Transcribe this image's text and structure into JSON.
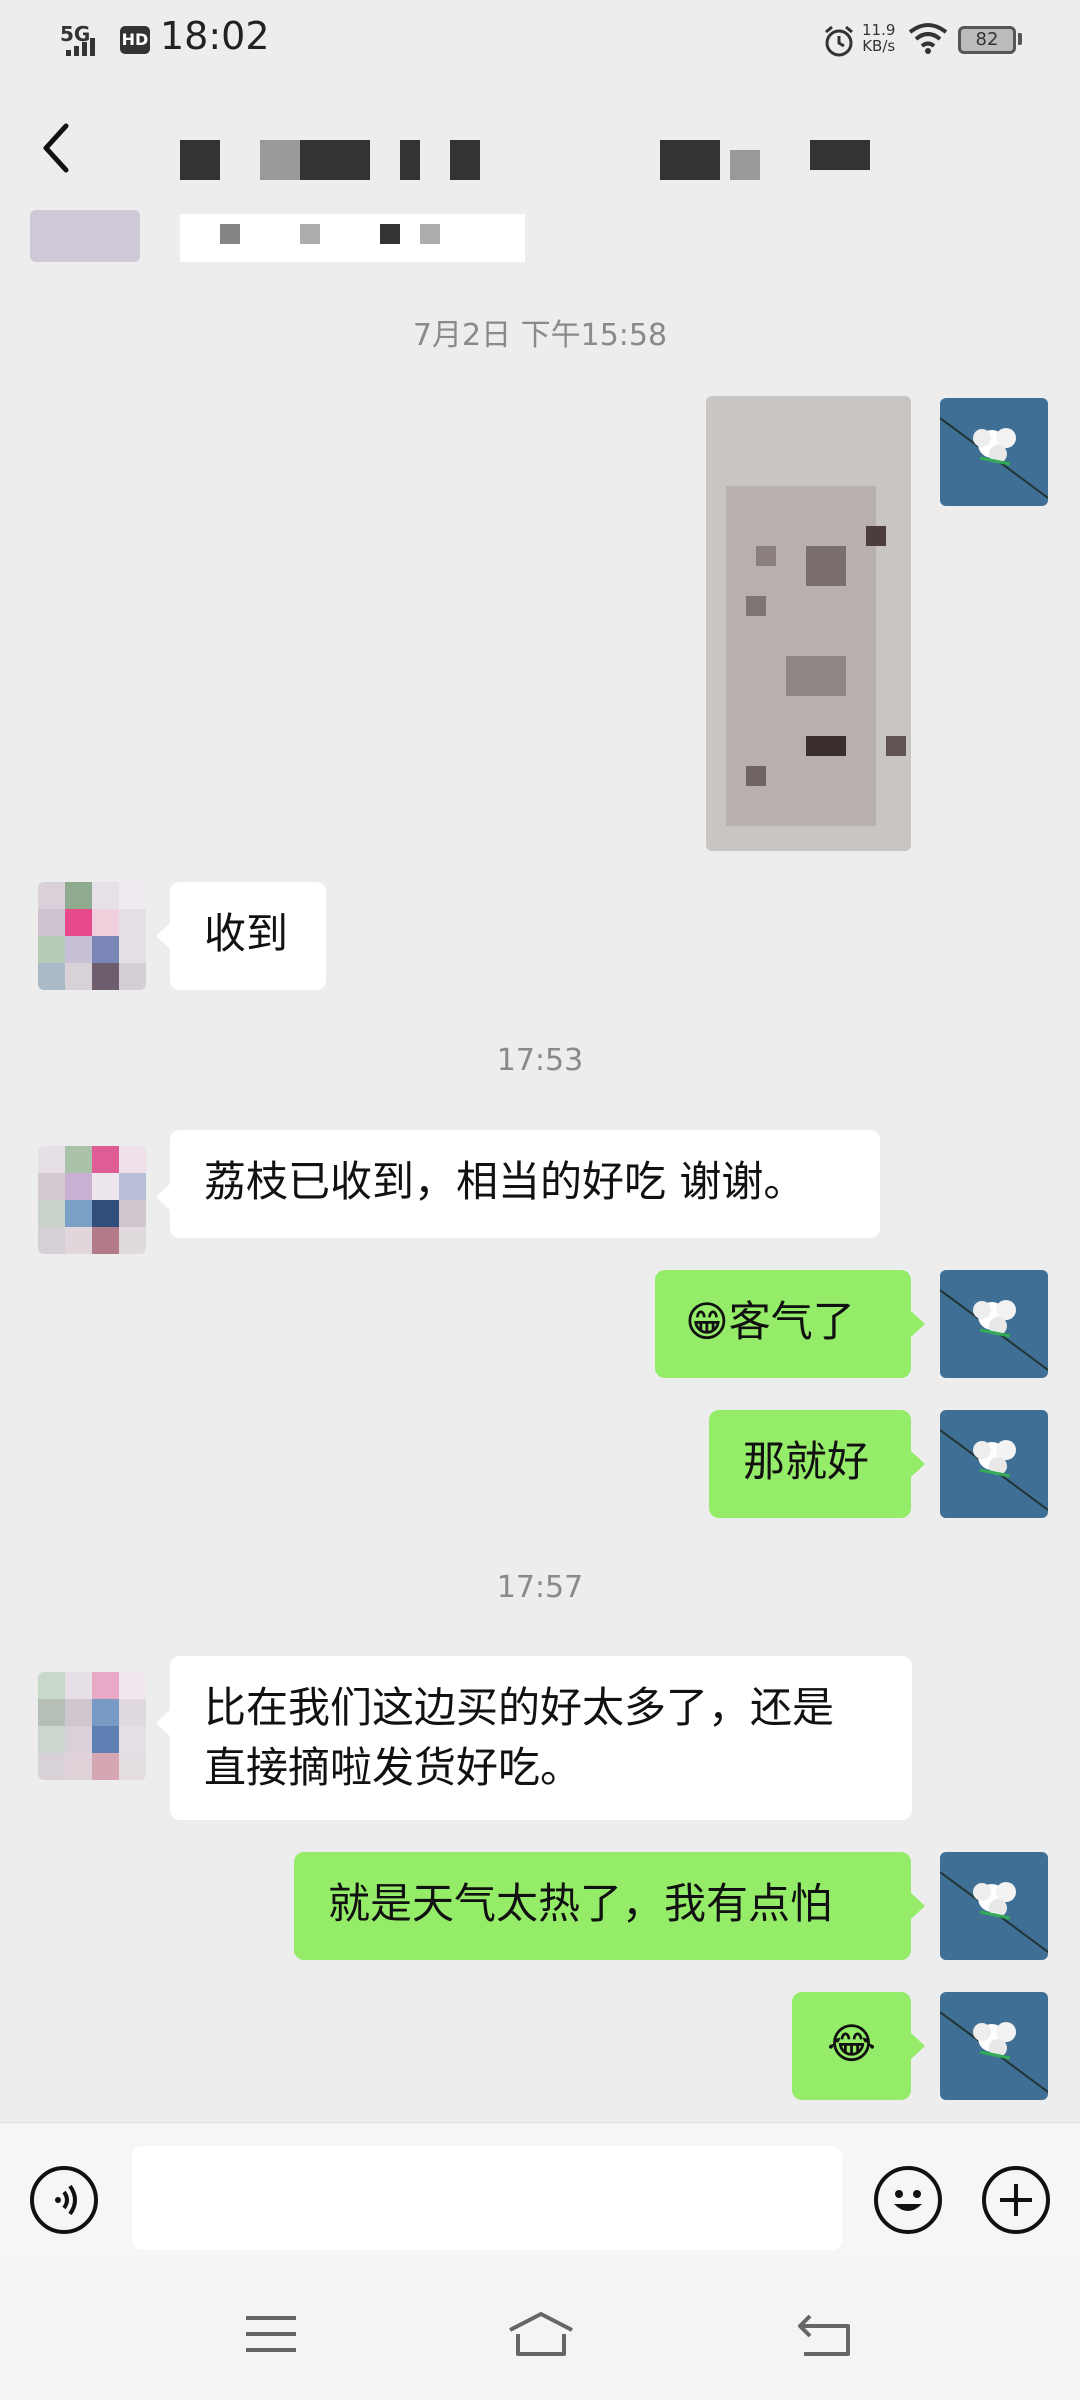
{
  "status_bar": {
    "network": "5G",
    "hd": "HD",
    "time": "18:02",
    "speed_value": "11.9",
    "speed_unit": "KB/s",
    "battery": "82"
  },
  "messages": {
    "ts1": "7月2日  下午15:58",
    "m_shoudao": "收到",
    "ts2": "17:53",
    "m_lizhi": "荔枝已收到，相当的好吃  谢谢。",
    "m_keqi": "客气了",
    "m_najiuhao": "那就好",
    "ts3": "17:57",
    "m_long_line1": "比在我们这边买的好太多了，还是",
    "m_long_line2": "直接摘啦发货好吃。",
    "m_tianqi": "就是天气太热了，我有点怕",
    "emoji_grin": "😁",
    "emoji_laugh": "😂"
  },
  "icons": {
    "back": "chevron-left-icon",
    "voice": "voice-icon",
    "emoji": "emoji-icon",
    "plus": "plus-icon",
    "menu": "menu-icon",
    "home": "home-icon",
    "return": "back-icon"
  },
  "colors": {
    "bg": "#ededed",
    "my_bubble": "#95ec69",
    "their_bubble": "#ffffff",
    "timestamp": "#8a8a8a"
  }
}
